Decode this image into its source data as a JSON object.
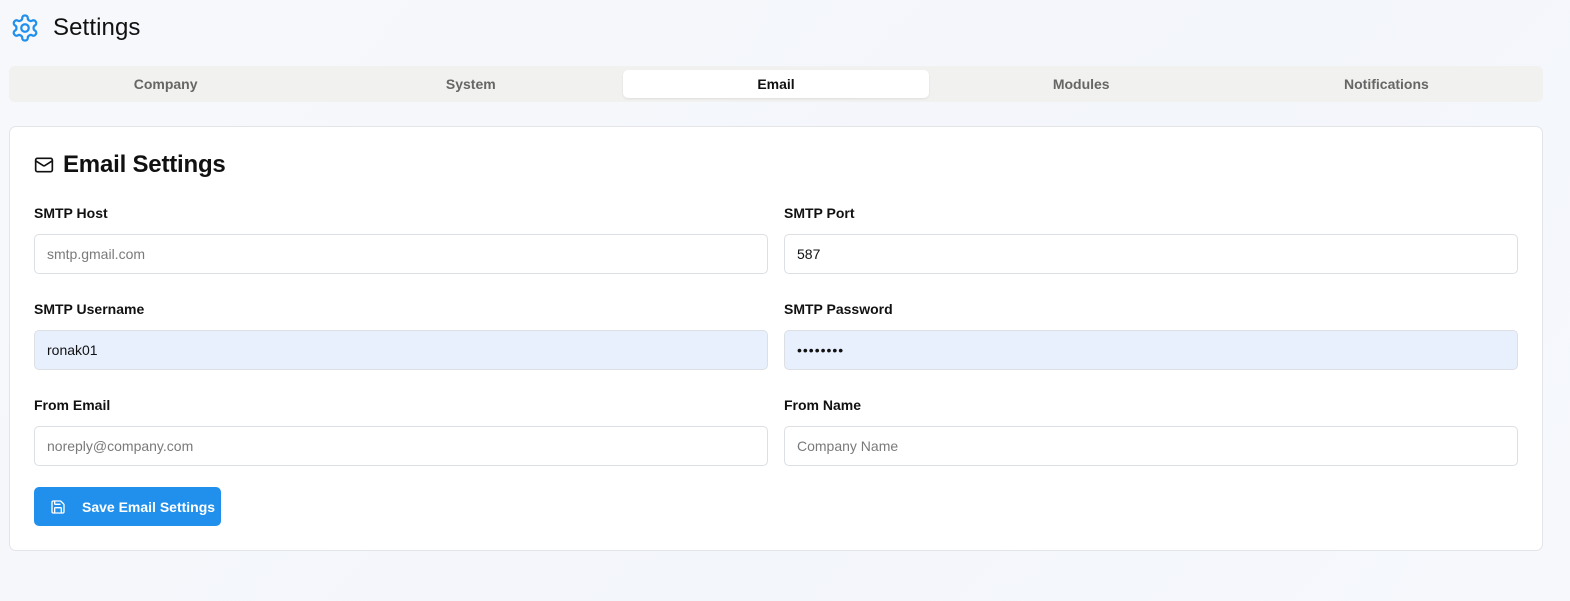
{
  "header": {
    "title": "Settings",
    "icon": "gear-icon",
    "accent": "#2190ec"
  },
  "tabs": [
    {
      "label": "Company",
      "active": false
    },
    {
      "label": "System",
      "active": false
    },
    {
      "label": "Email",
      "active": true
    },
    {
      "label": "Modules",
      "active": false
    },
    {
      "label": "Notifications",
      "active": false
    }
  ],
  "card": {
    "icon": "mail-icon",
    "title": "Email Settings",
    "fields": {
      "smtp_host": {
        "label": "SMTP Host",
        "placeholder": "smtp.gmail.com",
        "value": ""
      },
      "smtp_port": {
        "label": "SMTP Port",
        "placeholder": "",
        "value": "587"
      },
      "smtp_username": {
        "label": "SMTP Username",
        "placeholder": "",
        "value": "ronak01"
      },
      "smtp_password": {
        "label": "SMTP Password",
        "placeholder": "",
        "value": "••••••••"
      },
      "from_email": {
        "label": "From Email",
        "placeholder": "noreply@company.com",
        "value": ""
      },
      "from_name": {
        "label": "From Name",
        "placeholder": "Company Name",
        "value": ""
      }
    },
    "save_button": {
      "label": "Save Email Settings",
      "icon": "save-icon"
    }
  }
}
